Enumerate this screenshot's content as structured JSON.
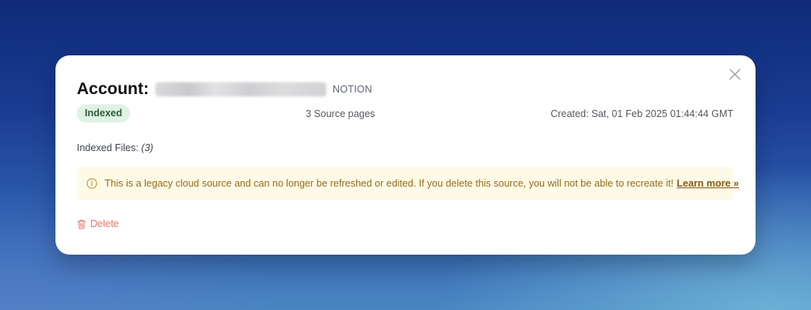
{
  "modal": {
    "title_label": "Account:",
    "provider": "NOTION",
    "close_icon": "close-icon"
  },
  "status": {
    "badge": "Indexed",
    "source_pages": "3 Source pages",
    "created": "Created: Sat, 01 Feb 2025 01:44:44 GMT"
  },
  "indexed_files": {
    "label": "Indexed Files:",
    "count": "(3)"
  },
  "notice": {
    "icon": "info-icon",
    "text": "This is a legacy cloud source and can no longer be refreshed or edited. If you delete this source, you will not be able to recreate it!",
    "link": "Learn more »"
  },
  "actions": {
    "delete_icon": "trash-icon",
    "delete_label": "Delete"
  },
  "colors": {
    "badge_bg": "#dff2e3",
    "notice_bg": "#fdfbe8",
    "notice_text": "#9a6a18",
    "delete": "#e27a6a"
  }
}
